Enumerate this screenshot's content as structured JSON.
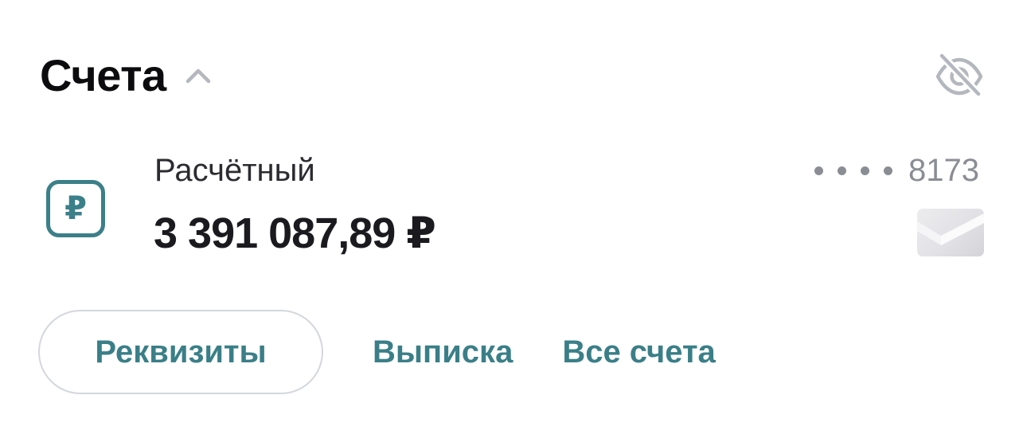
{
  "header": {
    "title": "Счета",
    "collapse_icon": "chevron-up-icon",
    "visibility_icon": "eye-off-icon"
  },
  "account": {
    "icon": "ruble-icon",
    "currency_symbol": "₽",
    "name": "Расчётный",
    "balance": "3 391 087,89 ₽",
    "number_mask": "••••",
    "number_last4": "8173",
    "card_icon": "card-thumbnail"
  },
  "actions": {
    "details_label": "Реквизиты",
    "statement_label": "Выписка",
    "all_accounts_label": "Все счета"
  },
  "colors": {
    "accent": "#3a7f88",
    "title": "#0c0c0e",
    "muted": "#8a8d93",
    "icon_gray": "#b4b8be",
    "button_border": "#d4d7dc"
  }
}
